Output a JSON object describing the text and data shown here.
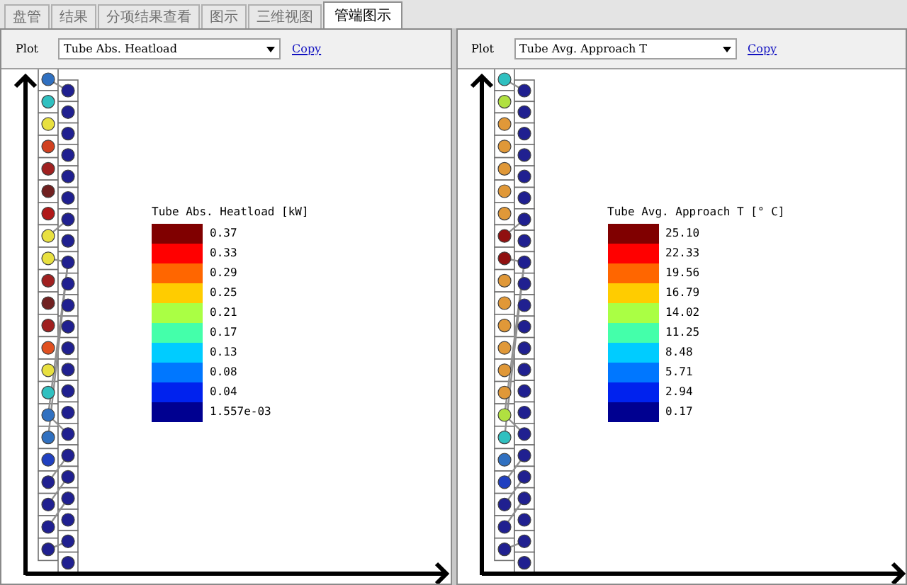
{
  "tabs": [
    {
      "label": "盘管",
      "selected": false
    },
    {
      "label": "结果",
      "selected": false
    },
    {
      "label": "分项结果查看",
      "selected": false
    },
    {
      "label": "图示",
      "selected": false
    },
    {
      "label": "三维视图",
      "selected": false
    },
    {
      "label": "管端图示",
      "selected": true
    }
  ],
  "panels": [
    {
      "plot_label": "Plot",
      "plot_value": "Tube Abs. Heatload",
      "copy_link": "Copy",
      "legend": {
        "title": "Tube Abs. Heatload [kW]",
        "entries": [
          {
            "label": "0.37",
            "color": "#800000"
          },
          {
            "label": "0.33",
            "color": "#ff0000"
          },
          {
            "label": "0.29",
            "color": "#ff6600"
          },
          {
            "label": "0.25",
            "color": "#ffcc00"
          },
          {
            "label": "0.21",
            "color": "#aaff44"
          },
          {
            "label": "0.17",
            "color": "#44ffaa"
          },
          {
            "label": "0.13",
            "color": "#00ccff"
          },
          {
            "label": "0.08",
            "color": "#0077ff"
          },
          {
            "label": "0.04",
            "color": "#0022ee"
          },
          {
            "label": "1.557e-03",
            "color": "#000090"
          }
        ]
      },
      "tubes_left": [
        {
          "color": "#3070c0"
        },
        {
          "color": "#30c0c0"
        },
        {
          "color": "#e8e040"
        },
        {
          "color": "#d04020"
        },
        {
          "color": "#a02020"
        },
        {
          "color": "#702020"
        },
        {
          "color": "#b01818"
        },
        {
          "color": "#e8e040"
        },
        {
          "color": "#e8e040"
        },
        {
          "color": "#a02020"
        },
        {
          "color": "#702020"
        },
        {
          "color": "#a02020"
        },
        {
          "color": "#e05020"
        },
        {
          "color": "#e8e040"
        },
        {
          "color": "#30c0c0"
        },
        {
          "color": "#3070c0"
        },
        {
          "color": "#3070c0"
        },
        {
          "color": "#2040c0"
        },
        {
          "color": "#202090"
        },
        {
          "color": "#202090"
        },
        {
          "color": "#202090"
        },
        {
          "color": "#202090"
        }
      ],
      "tubes_right": [
        {
          "color": "#202090"
        },
        {
          "color": "#202090"
        },
        {
          "color": "#202090"
        },
        {
          "color": "#202090"
        },
        {
          "color": "#202090"
        },
        {
          "color": "#202090"
        },
        {
          "color": "#202090"
        },
        {
          "color": "#202090"
        },
        {
          "color": "#202090"
        },
        {
          "color": "#202090"
        },
        {
          "color": "#202090"
        },
        {
          "color": "#202090"
        },
        {
          "color": "#202090"
        },
        {
          "color": "#202090"
        },
        {
          "color": "#202090"
        },
        {
          "color": "#202090"
        },
        {
          "color": "#202090"
        },
        {
          "color": "#202090"
        },
        {
          "color": "#202090"
        },
        {
          "color": "#202090"
        },
        {
          "color": "#202090"
        },
        {
          "color": "#202090"
        },
        {
          "color": "#202090"
        }
      ]
    },
    {
      "plot_label": "Plot",
      "plot_value": "Tube Avg. Approach T",
      "copy_link": "Copy",
      "legend": {
        "title": "Tube Avg. Approach T [° C]",
        "entries": [
          {
            "label": "25.10",
            "color": "#800000"
          },
          {
            "label": "22.33",
            "color": "#ff0000"
          },
          {
            "label": "19.56",
            "color": "#ff6600"
          },
          {
            "label": "16.79",
            "color": "#ffcc00"
          },
          {
            "label": "14.02",
            "color": "#aaff44"
          },
          {
            "label": "11.25",
            "color": "#44ffaa"
          },
          {
            "label": "8.48",
            "color": "#00ccff"
          },
          {
            "label": "5.71",
            "color": "#0077ff"
          },
          {
            "label": "2.94",
            "color": "#0022ee"
          },
          {
            "label": "0.17",
            "color": "#000090"
          }
        ]
      },
      "tubes_left": [
        {
          "color": "#30c0c0"
        },
        {
          "color": "#b0e040"
        },
        {
          "color": "#e09838"
        },
        {
          "color": "#e09838"
        },
        {
          "color": "#e09838"
        },
        {
          "color": "#e09838"
        },
        {
          "color": "#e09838"
        },
        {
          "color": "#901010"
        },
        {
          "color": "#901010"
        },
        {
          "color": "#e09838"
        },
        {
          "color": "#e09838"
        },
        {
          "color": "#e09838"
        },
        {
          "color": "#e09838"
        },
        {
          "color": "#e09838"
        },
        {
          "color": "#e09838"
        },
        {
          "color": "#b0e040"
        },
        {
          "color": "#30c0c0"
        },
        {
          "color": "#3070c0"
        },
        {
          "color": "#2040c0"
        },
        {
          "color": "#202090"
        },
        {
          "color": "#202090"
        },
        {
          "color": "#202090"
        }
      ],
      "tubes_right": [
        {
          "color": "#202090"
        },
        {
          "color": "#202090"
        },
        {
          "color": "#202090"
        },
        {
          "color": "#202090"
        },
        {
          "color": "#202090"
        },
        {
          "color": "#202090"
        },
        {
          "color": "#202090"
        },
        {
          "color": "#202090"
        },
        {
          "color": "#202090"
        },
        {
          "color": "#202090"
        },
        {
          "color": "#202090"
        },
        {
          "color": "#202090"
        },
        {
          "color": "#202090"
        },
        {
          "color": "#202090"
        },
        {
          "color": "#202090"
        },
        {
          "color": "#202090"
        },
        {
          "color": "#202090"
        },
        {
          "color": "#202090"
        },
        {
          "color": "#202090"
        },
        {
          "color": "#202090"
        },
        {
          "color": "#202090"
        },
        {
          "color": "#202090"
        },
        {
          "color": "#202090"
        }
      ]
    }
  ]
}
